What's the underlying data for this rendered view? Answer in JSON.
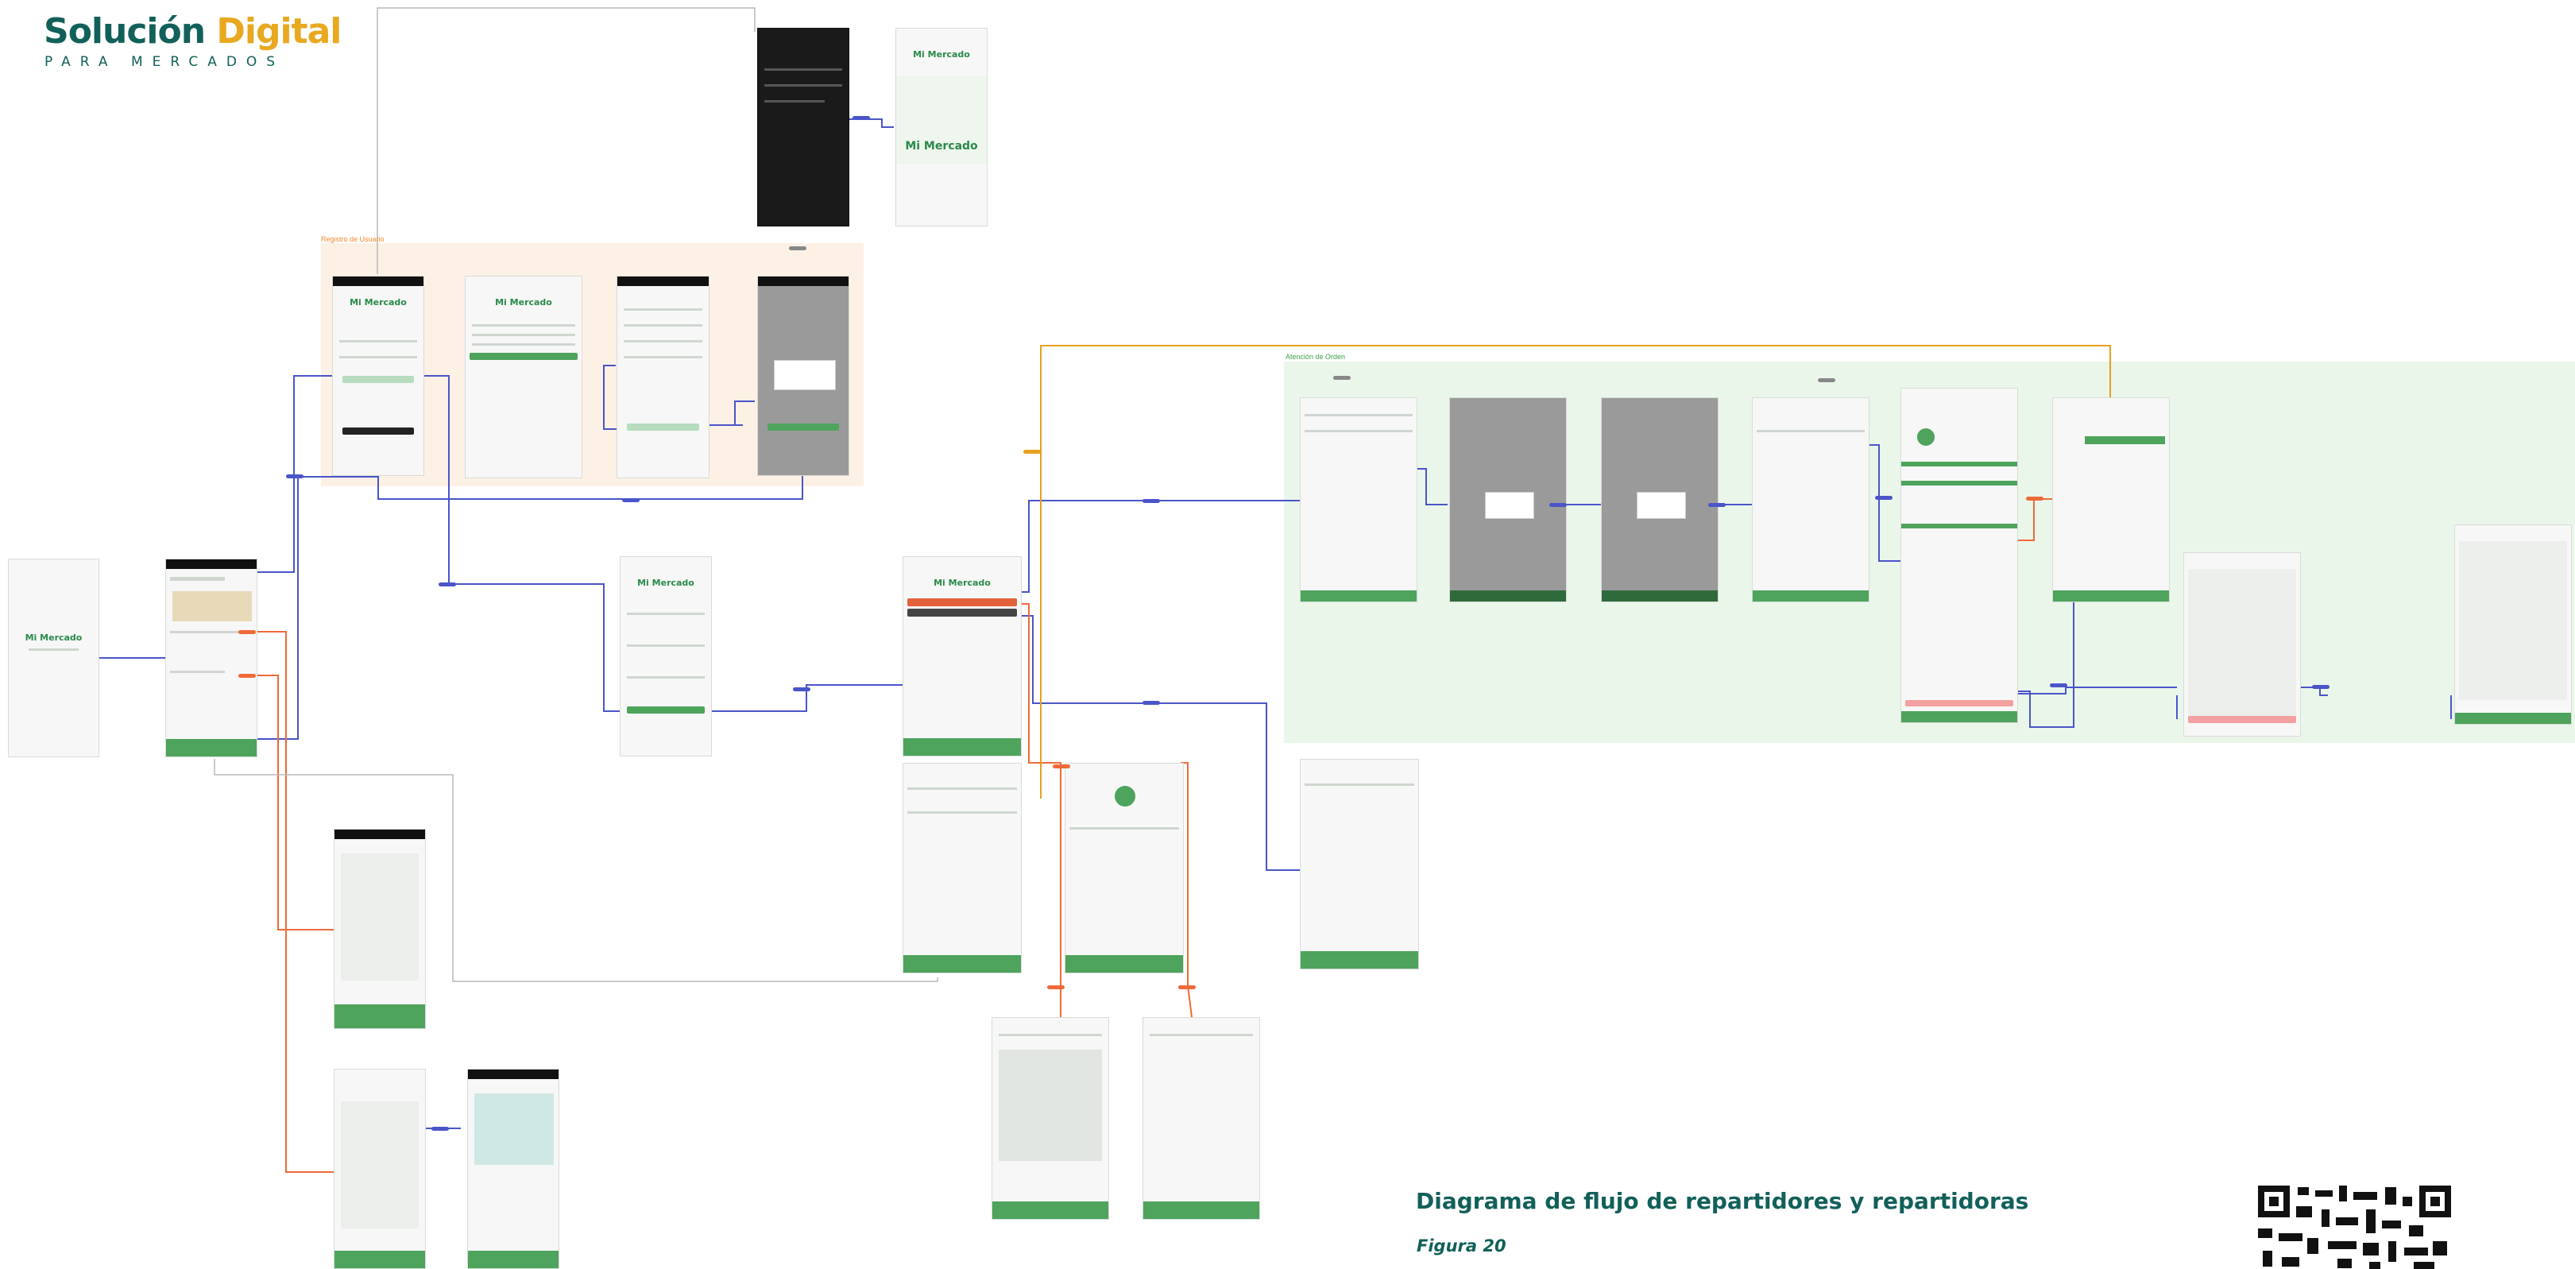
{
  "logo": {
    "word1": "Solución",
    "word2": "Digital",
    "tagline": "PARA MERCADOS"
  },
  "brand_colors": {
    "teal": "#12605a",
    "gold": "#e8a820",
    "green": "#4ea35d",
    "flow_blue": "#4a55c9",
    "flow_orange": "#ef6a3a",
    "region_orange": "#fdf1e6",
    "region_green": "#eaf6ea"
  },
  "regions": {
    "registro": "Registro de Usuario",
    "atencion": "Atención de Orden"
  },
  "caption": {
    "title": "Diagrama de flujo de repartidores y repartidoras",
    "figure": "Figura 20"
  },
  "app_title": "Mi Mercado"
}
